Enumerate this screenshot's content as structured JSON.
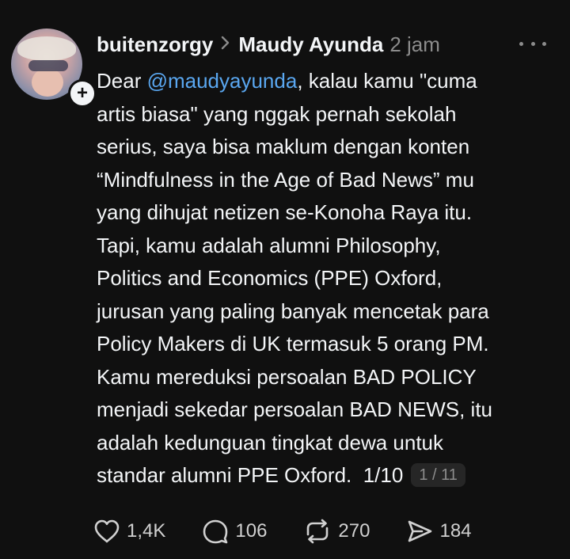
{
  "post": {
    "username": "buitenzorgy",
    "reply_to": "Maudy Ayunda",
    "time": "2 jam",
    "follow_symbol": "+",
    "lines": [
      {
        "pre": "Dear ",
        "mention": "@maudyayunda",
        "post": ", kalau kamu \"cuma"
      },
      {
        "text": "artis biasa\" yang nggak pernah sekolah"
      },
      {
        "text": "serius, saya bisa maklum dengan konten"
      },
      {
        "text": "“Mindfulness in the Age of Bad News” mu"
      },
      {
        "text": "yang dihujat netizen se-Konoha Raya itu."
      },
      {
        "text": "Tapi, kamu adalah alumni Philosophy,"
      },
      {
        "text": "Politics and Economics (PPE) Oxford,"
      },
      {
        "text": "jurusan yang paling banyak mencetak para"
      },
      {
        "text": "Policy Makers di UK termasuk 5 orang PM."
      },
      {
        "text": "Kamu mereduksi persoalan BAD POLICY"
      },
      {
        "text": "menjadi sekedar persoalan BAD NEWS, itu"
      },
      {
        "text": "adalah kedunguan tingkat dewa untuk"
      },
      {
        "text": "standar alumni PPE Oxford.  1/10"
      }
    ],
    "thread_badge": "1 / 11"
  },
  "actions": {
    "like": {
      "icon": "heart-icon",
      "count": "1,4K"
    },
    "comment": {
      "icon": "comment-icon",
      "count": "106"
    },
    "repost": {
      "icon": "repost-icon",
      "count": "270"
    },
    "share": {
      "icon": "send-icon",
      "count": "184"
    }
  },
  "colors": {
    "background": "#101010",
    "text": "#f3f5f7",
    "muted": "#8c8c8c",
    "mention": "#5aa7f0"
  }
}
